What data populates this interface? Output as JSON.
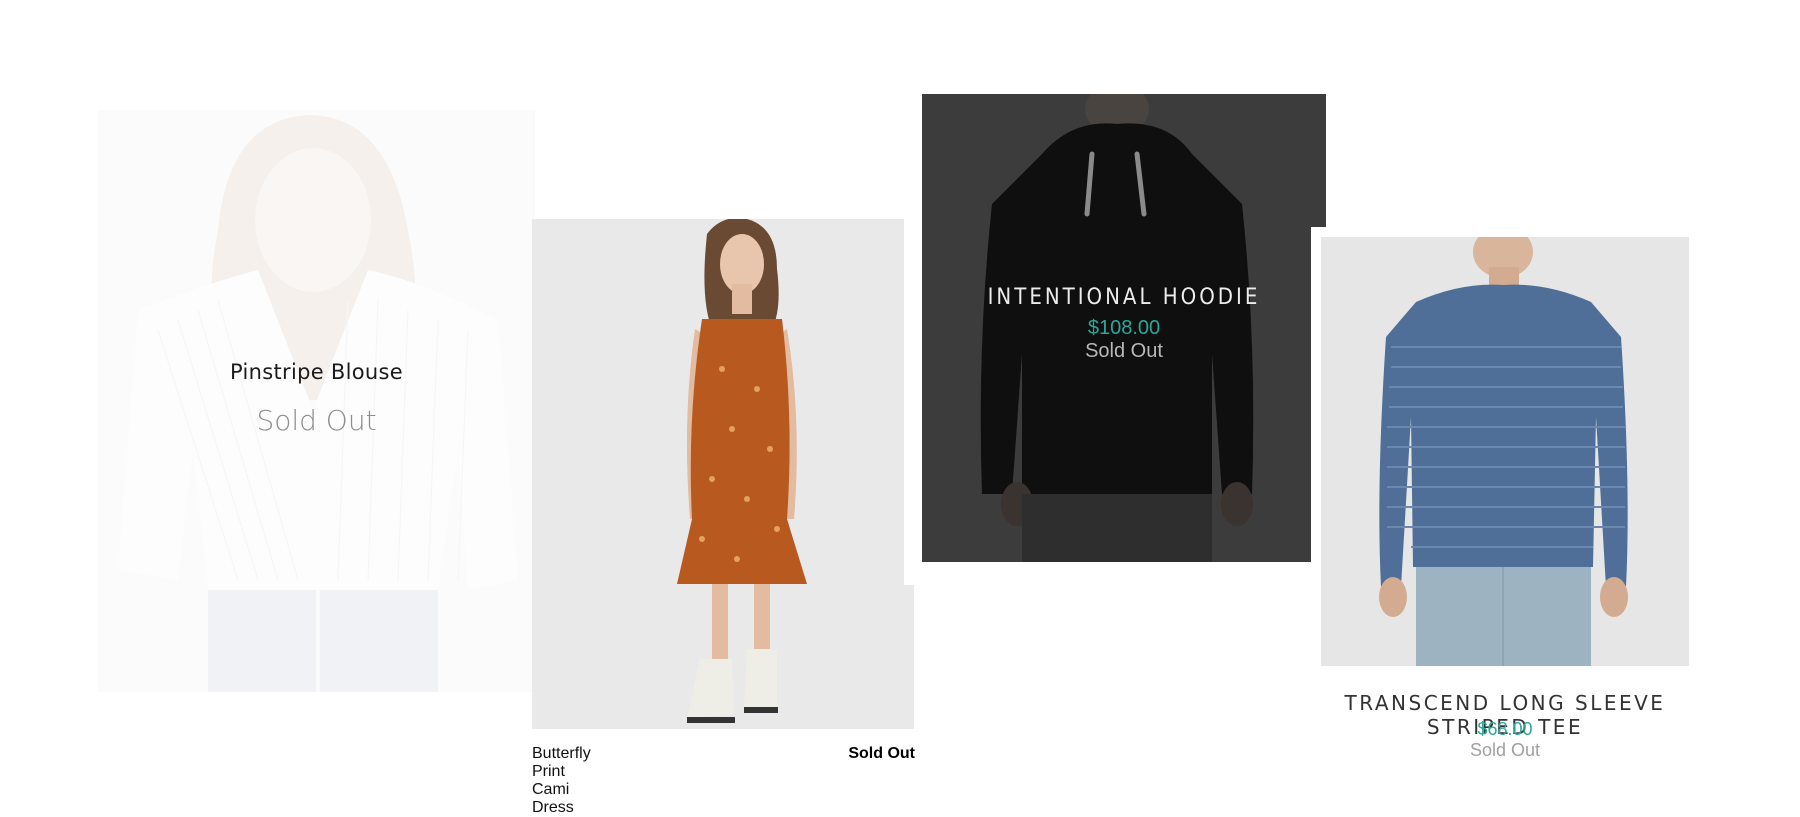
{
  "products": [
    {
      "name": "Pinstripe Blouse",
      "status": "Sold Out",
      "image": "woman-in-pinstripe-blouse"
    },
    {
      "name": "Butterfly Print Cami Dress",
      "status": "Sold Out",
      "image": "woman-in-rust-floral-cami-dress"
    },
    {
      "name": "INTENTIONAL HOODIE",
      "price": "$108.00",
      "status": "Sold Out",
      "image": "man-in-black-hoodie"
    },
    {
      "name": "TRANSCEND LONG SLEEVE STRIPED TEE",
      "price": "$68.00",
      "status": "Sold Out",
      "image": "man-in-blue-striped-long-sleeve-tee"
    }
  ],
  "colors": {
    "price_accent": "#2ba79a",
    "dark_overlay": "#3c3c3c"
  }
}
